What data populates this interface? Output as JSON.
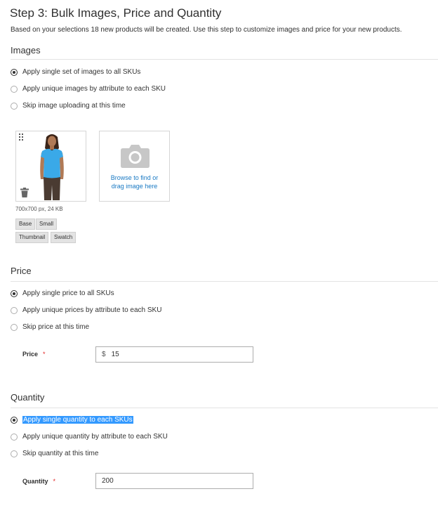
{
  "header": {
    "title": "Step 3: Bulk Images, Price and Quantity",
    "subtitle": "Based on your selections 18 new products will be created. Use this step to customize images and price for your new products."
  },
  "images": {
    "title": "Images",
    "options": [
      {
        "label": "Apply single set of images to all SKUs",
        "checked": true
      },
      {
        "label": "Apply unique images by attribute to each SKU",
        "checked": false
      },
      {
        "label": "Skip image uploading at this time",
        "checked": false
      }
    ],
    "image_info": "700x700 px, 24 KB",
    "roles": [
      "Base",
      "Small",
      "Thumbnail",
      "Swatch"
    ],
    "browse_line1": "Browse to find or",
    "browse_line2": "drag image here",
    "colors": {
      "shirt": "#3aa9e8",
      "link": "#1979c3"
    }
  },
  "price": {
    "title": "Price",
    "options": [
      {
        "label": "Apply single price to all SKUs",
        "checked": true
      },
      {
        "label": "Apply unique prices by attribute to each SKU",
        "checked": false
      },
      {
        "label": "Skip price at this time",
        "checked": false
      }
    ],
    "field_label": "Price",
    "required_mark": "*",
    "currency": "$",
    "value": "15"
  },
  "quantity": {
    "title": "Quantity",
    "options": [
      {
        "label": "Apply single quantity to each SKUs",
        "checked": true,
        "selected_text": true
      },
      {
        "label": "Apply unique quantity by attribute to each SKU",
        "checked": false
      },
      {
        "label": "Skip quantity at this time",
        "checked": false
      }
    ],
    "field_label": "Quantity",
    "required_mark": "*",
    "value": "200"
  }
}
